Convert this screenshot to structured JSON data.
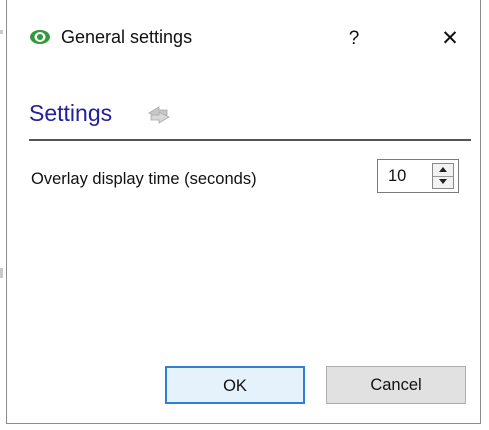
{
  "dialog": {
    "title": "General settings",
    "help_label": "?",
    "close_label": "✕",
    "icon": "eye-icon"
  },
  "section": {
    "title": "Settings",
    "icon": "refresh-arrows-icon"
  },
  "fields": {
    "overlay_label": "Overlay display time (seconds)",
    "overlay_value": "10"
  },
  "buttons": {
    "ok_label": "OK",
    "cancel_label": "Cancel"
  },
  "colors": {
    "section_title": "#24209c",
    "ok_border": "#2f7fd6",
    "ok_fill": "#e5f1fb",
    "icon_green": "#2f9a3a"
  }
}
